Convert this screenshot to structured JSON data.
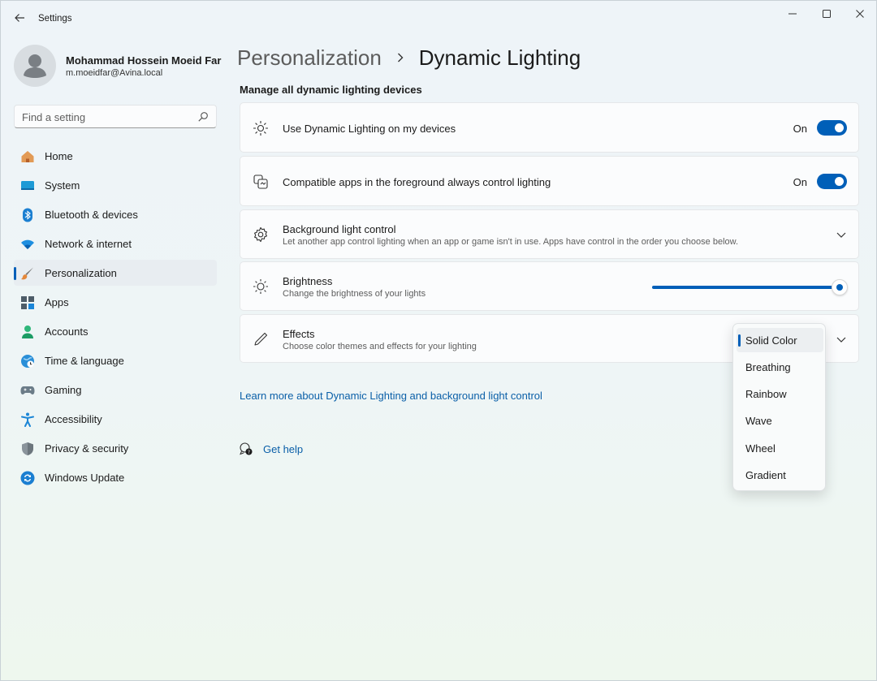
{
  "app": {
    "title": "Settings"
  },
  "profile": {
    "name": "Mohammad Hossein Moeid Far",
    "email": "m.moeidfar@Avina.local"
  },
  "search": {
    "placeholder": "Find a setting"
  },
  "sidebar": {
    "items": [
      {
        "label": "Home",
        "icon": "home-icon"
      },
      {
        "label": "System",
        "icon": "system-icon"
      },
      {
        "label": "Bluetooth & devices",
        "icon": "bluetooth-icon"
      },
      {
        "label": "Network & internet",
        "icon": "wifi-icon"
      },
      {
        "label": "Personalization",
        "icon": "brush-icon",
        "selected": true
      },
      {
        "label": "Apps",
        "icon": "apps-icon"
      },
      {
        "label": "Accounts",
        "icon": "accounts-icon"
      },
      {
        "label": "Time & language",
        "icon": "globe-icon"
      },
      {
        "label": "Gaming",
        "icon": "gamepad-icon"
      },
      {
        "label": "Accessibility",
        "icon": "accessibility-icon"
      },
      {
        "label": "Privacy & security",
        "icon": "shield-icon"
      },
      {
        "label": "Windows Update",
        "icon": "update-icon"
      }
    ]
  },
  "breadcrumb": {
    "parent": "Personalization",
    "current": "Dynamic Lighting"
  },
  "main": {
    "section_title": "Manage all dynamic lighting devices",
    "use_dynamic": {
      "title": "Use Dynamic Lighting on my devices",
      "state": "On"
    },
    "compatible_apps": {
      "title": "Compatible apps in the foreground always control lighting",
      "state": "On"
    },
    "background_control": {
      "title": "Background light control",
      "desc": "Let another app control lighting when an app or game isn't in use. Apps have control in the order you choose below."
    },
    "brightness": {
      "title": "Brightness",
      "desc": "Change the brightness of your lights",
      "value_fraction": 1.0
    },
    "effects": {
      "title": "Effects",
      "desc": "Choose color themes and effects for your lighting",
      "selected": "Solid Color"
    },
    "learn_more": "Learn more about Dynamic Lighting and background light control",
    "get_help": "Get help"
  },
  "dropdown": {
    "options": [
      "Solid Color",
      "Breathing",
      "Rainbow",
      "Wave",
      "Wheel",
      "Gradient"
    ]
  },
  "colors": {
    "accent": "#005fb8",
    "link": "#0a5fa8"
  }
}
